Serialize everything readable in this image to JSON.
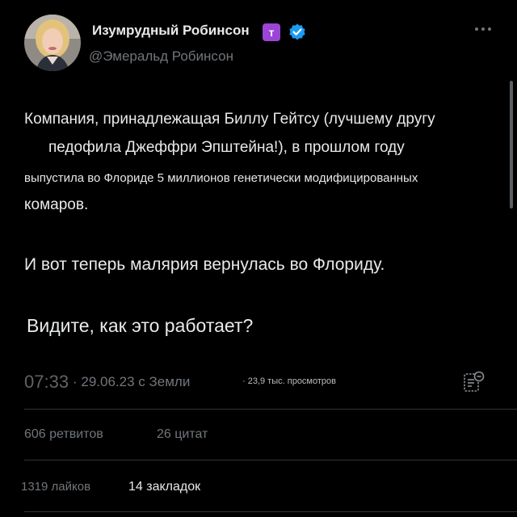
{
  "author": {
    "display_name": "Изумрудный Робинсон",
    "badge_letter": "т",
    "handle": "@Эмеральд Робинсон",
    "avatar_icon": "profile-photo",
    "verified_icon": "verified-check-icon"
  },
  "tweet": {
    "lines": [
      "Компания, принадлежащая Биллу Гейтсу (лучшему другу",
      "педофила Джеффри Эпштейна!), в прошлом году",
      "выпустила во Флориде 5 миллионов генетически модифицированных",
      "комаров.",
      "И вот теперь малярия вернулась во Флориду.",
      "Видите, как это работает?"
    ]
  },
  "meta": {
    "time": "07:33",
    "date": "· 29.06.23 с Земли",
    "views": "· 23,9 тыс. просмотров"
  },
  "stats": {
    "retweets": "606 ретвитов",
    "quotes": "26 цитат",
    "likes": "1319 лайков",
    "bookmarks": "14 закладок"
  },
  "colors": {
    "background": "#000000",
    "text": "#e7e9ea",
    "muted": "#71767b",
    "badge": "#9b45d6",
    "verified": "#1d9bf0"
  }
}
